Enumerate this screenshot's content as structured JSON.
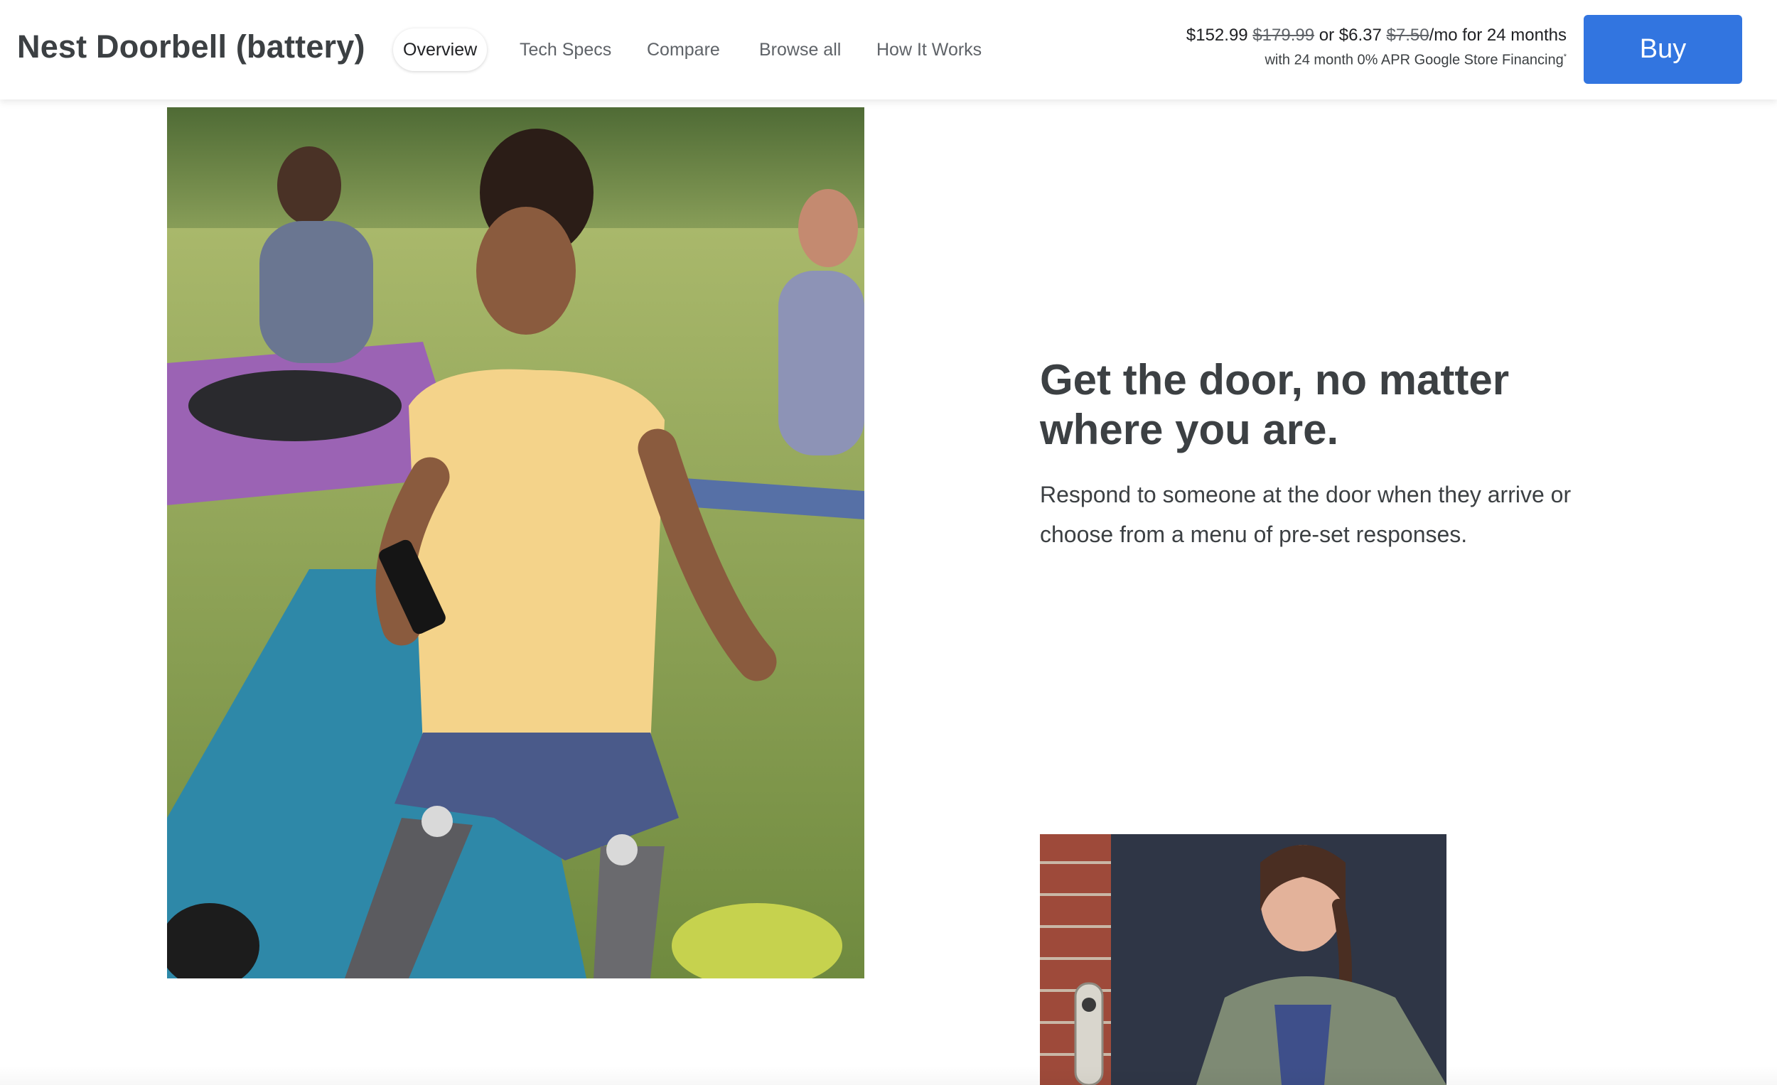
{
  "header": {
    "product_title": "Nest Doorbell (battery)",
    "nav": [
      {
        "label": "Overview",
        "active": true
      },
      {
        "label": "Tech Specs",
        "active": false
      },
      {
        "label": "Compare",
        "active": false
      },
      {
        "label": "Browse all",
        "active": false
      },
      {
        "label": "How It Works",
        "active": false
      }
    ],
    "price": {
      "current": "$152.99",
      "original": "$179.99",
      "or_text": "or",
      "monthly_current": "$6.37",
      "monthly_original": "$7.50",
      "monthly_suffix": "/mo for 24 months",
      "financing": "with 24 month 0% APR Google Store Financing",
      "footnote_marker": "*"
    },
    "buy_label": "Buy"
  },
  "feature": {
    "heading": "Get the door, no matter where you are.",
    "body": "Respond to someone at the door when they arrive or choose from a menu of pre-set responses."
  },
  "colors": {
    "buy_button": "#3275e0",
    "text_primary": "#202124",
    "text_secondary": "#5f6368"
  }
}
